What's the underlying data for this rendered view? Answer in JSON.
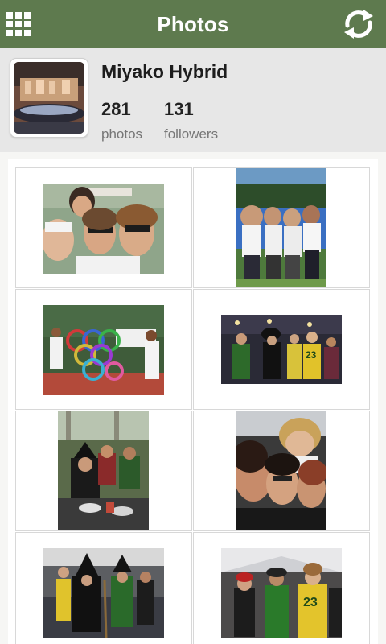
{
  "header": {
    "title": "Photos",
    "menu_icon": "grid-icon",
    "refresh_icon": "refresh-icon",
    "bar_color": "#5e7a4e"
  },
  "profile": {
    "name": "Miyako Hybrid",
    "photos_count": "281",
    "photos_label": "photos",
    "followers_count": "131",
    "followers_label": "followers"
  },
  "photos": [
    {
      "name": "group-selfie-four-women",
      "orientation": "landscape"
    },
    {
      "name": "women-in-white-shirts-outdoors",
      "orientation": "portrait"
    },
    {
      "name": "olympic-rings-sculpture",
      "orientation": "landscape"
    },
    {
      "name": "costume-party-group",
      "orientation": "landscape"
    },
    {
      "name": "witches-dinner-table",
      "orientation": "portrait"
    },
    {
      "name": "selfie-three-friends",
      "orientation": "portrait"
    },
    {
      "name": "halloween-witch-costumes",
      "orientation": "landscape"
    },
    {
      "name": "football-jersey-costumes",
      "orientation": "landscape"
    }
  ]
}
